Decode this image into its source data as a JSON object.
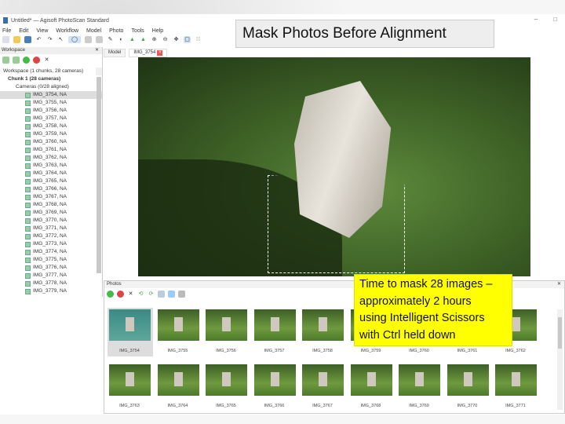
{
  "window": {
    "title": "Untitled* — Agisoft PhotoScan Standard"
  },
  "menu": [
    "File",
    "Edit",
    "View",
    "Workflow",
    "Model",
    "Photo",
    "Tools",
    "Help"
  ],
  "workspace": {
    "header": "Workspace",
    "root": "Workspace (1 chunks, 28 cameras)",
    "chunk": "Chunk 1 (28 cameras)",
    "cameras": "Cameras (0/28 aligned)",
    "items": [
      "IMG_3754, NA",
      "IMG_3755, NA",
      "IMG_3756, NA",
      "IMG_3757, NA",
      "IMG_3758, NA",
      "IMG_3759, NA",
      "IMG_3760, NA",
      "IMG_3761, NA",
      "IMG_3762, NA",
      "IMG_3763, NA",
      "IMG_3764, NA",
      "IMG_3765, NA",
      "IMG_3766, NA",
      "IMG_3767, NA",
      "IMG_3768, NA",
      "IMG_3769, NA",
      "IMG_3770, NA",
      "IMG_3771, NA",
      "IMG_3772, NA",
      "IMG_3773, NA",
      "IMG_3774, NA",
      "IMG_3775, NA",
      "IMG_3776, NA",
      "IMG_3777, NA",
      "IMG_3778, NA",
      "IMG_3779, NA"
    ]
  },
  "tabs": [
    "Model",
    "IMG_3754"
  ],
  "slide_title": "Mask Photos Before Alignment",
  "photos": {
    "header": "Photos",
    "thumbs": [
      "IMG_3754",
      "IMG_3755",
      "IMG_3756",
      "IMG_3757",
      "IMG_3758",
      "IMG_3759",
      "IMG_3760",
      "IMG_3761",
      "IMG_3762",
      "IMG_3763",
      "IMG_3764",
      "IMG_3765",
      "IMG_3766",
      "IMG_3767",
      "IMG_3768",
      "IMG_3769",
      "IMG_3770",
      "IMG_3771"
    ]
  },
  "note": {
    "lines": [
      "Time to mask 28 images –",
      "approximately 2 hours",
      "using Intelligent Scissors",
      "with Ctrl held down"
    ]
  }
}
